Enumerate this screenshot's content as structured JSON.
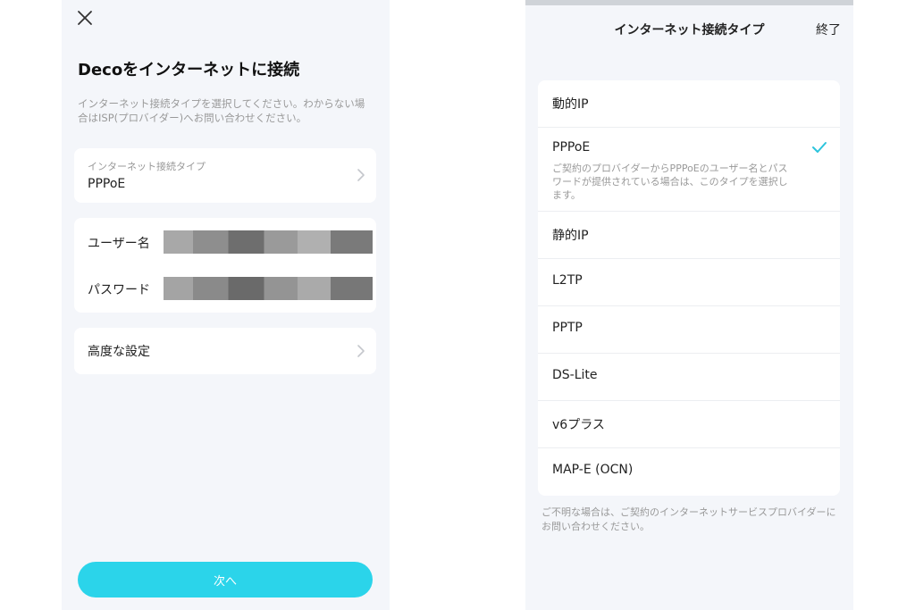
{
  "left": {
    "title": "Decoをインターネットに接続",
    "description": "インターネット接続タイプを選択してください。わからない場合はISP(プロバイダー)へお問い合わせください。",
    "connection_type": {
      "label": "インターネット接続タイプ",
      "value": "PPPoE"
    },
    "username": {
      "label": "ユーザー名",
      "value": ""
    },
    "password": {
      "label": "パスワード",
      "value": ""
    },
    "advanced": {
      "label": "高度な設定"
    },
    "next_label": "次へ",
    "icons": {
      "close": "close-icon",
      "chevron": "chevron-right-icon"
    }
  },
  "right": {
    "title": "インターネット接続タイプ",
    "done_label": "終了",
    "options": [
      {
        "label": "動的IP"
      },
      {
        "label": "PPPoE",
        "selected": true,
        "description": "ご契約のプロバイダーからPPPoEのユーザー名とパスワードが提供されている場合は、このタイプを選択します。"
      },
      {
        "label": "静的IP"
      },
      {
        "label": "L2TP"
      },
      {
        "label": "PPTP"
      },
      {
        "label": "DS-Lite"
      },
      {
        "label": "v6プラス"
      },
      {
        "label": "MAP-E (OCN)"
      }
    ],
    "footer_note": "ご不明な場合は、ご契約のインターネットサービスプロバイダーにお問い合わせください。",
    "icons": {
      "check": "checkmark-icon"
    }
  },
  "colors": {
    "accent": "#2bd4ea",
    "background": "#f4f6fa",
    "card": "#ffffff",
    "muted_text": "#999999",
    "check": "#2bc4dc"
  }
}
